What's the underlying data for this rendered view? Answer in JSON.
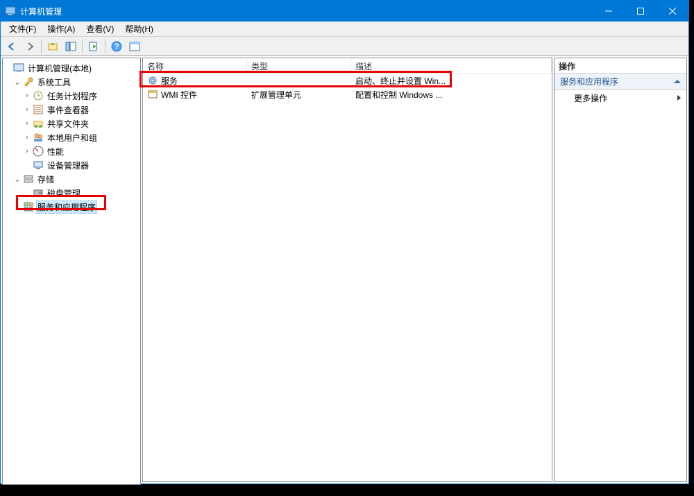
{
  "title": "计算机管理",
  "menu": {
    "file": "文件(F)",
    "action": "操作(A)",
    "view": "查看(V)",
    "help": "帮助(H)"
  },
  "tree": {
    "root": "计算机管理(本地)",
    "systools": "系统工具",
    "tasks": "任务计划程序",
    "events": "事件查看器",
    "shared": "共享文件夹",
    "users": "本地用户和组",
    "perf": "性能",
    "devmgr": "设备管理器",
    "storage": "存储",
    "disk": "磁盘管理",
    "svcapps": "服务和应用程序"
  },
  "cols": {
    "name": "名称",
    "type": "类型",
    "desc": "描述"
  },
  "rows": [
    {
      "name": "服务",
      "type": "",
      "desc": "启动、终止并设置 Win..."
    },
    {
      "name": "WMI 控件",
      "type": "扩展管理单元",
      "desc": "配置和控制 Windows ..."
    }
  ],
  "actions": {
    "header": "操作",
    "section": "服务和应用程序",
    "more": "更多操作"
  }
}
